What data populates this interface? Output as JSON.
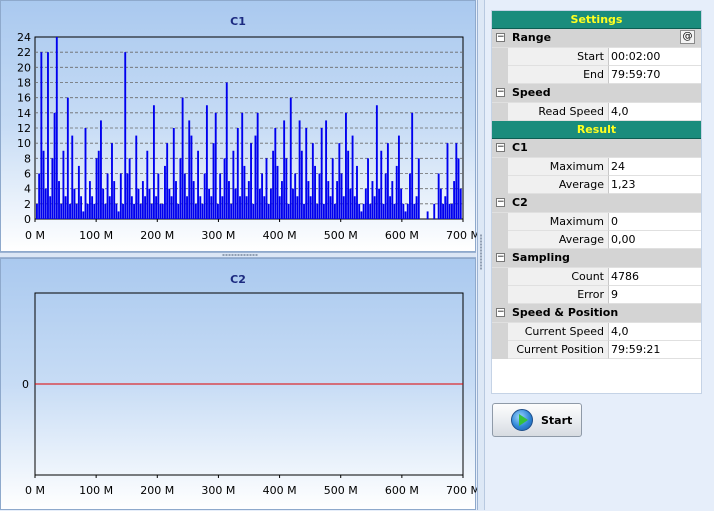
{
  "chart_c1": {
    "title": "C1",
    "y_ticks": [
      "0",
      "2",
      "4",
      "6",
      "8",
      "10",
      "12",
      "14",
      "16",
      "18",
      "20",
      "22",
      "24"
    ],
    "x_ticks": [
      "0 M",
      "100 M",
      "200 M",
      "300 M",
      "400 M",
      "500 M",
      "600 M",
      "700 M"
    ],
    "colors": {
      "series": "#0000ee",
      "grid": "#6a6a6a"
    }
  },
  "chart_c2": {
    "title": "C2",
    "y_ticks": [
      "0"
    ],
    "x_ticks": [
      "0 M",
      "100 M",
      "200 M",
      "300 M",
      "400 M",
      "500 M",
      "600 M",
      "700 M"
    ],
    "colors": {
      "series": "#e00000"
    }
  },
  "chart_data": [
    {
      "type": "bar",
      "title": "C1",
      "xlabel": "",
      "ylabel": "",
      "xlim": [
        0,
        700
      ],
      "ylim": [
        0,
        24
      ],
      "grid": true,
      "series": [
        {
          "values": [
            2,
            6,
            22,
            9,
            4,
            22,
            3,
            8,
            14,
            24,
            5,
            2,
            9,
            3,
            16,
            2,
            11,
            4,
            2,
            7,
            3,
            1,
            12,
            2,
            5,
            3,
            2,
            8,
            9,
            13,
            4,
            2,
            6,
            3,
            10,
            5,
            2,
            1,
            6,
            2,
            22,
            6,
            8,
            3,
            2,
            11,
            4,
            2,
            5,
            3,
            9,
            4,
            2,
            15,
            3,
            6,
            2,
            2,
            7,
            10,
            4,
            3,
            12,
            5,
            2,
            8,
            16,
            6,
            3,
            13,
            11,
            5,
            2,
            9,
            3,
            2,
            6,
            15,
            4,
            3,
            10,
            14,
            2,
            6,
            3,
            8,
            18,
            5,
            2,
            9,
            4,
            12,
            3,
            14,
            7,
            3,
            5,
            10,
            2,
            11,
            14,
            4,
            6,
            3,
            8,
            2,
            4,
            9,
            12,
            7,
            3,
            5,
            13,
            8,
            2,
            16,
            4,
            6,
            3,
            13,
            9,
            2,
            12,
            5,
            3,
            10,
            7,
            2,
            6,
            12,
            2,
            13,
            5,
            3,
            8,
            2,
            5,
            10,
            6,
            3,
            14,
            9,
            4,
            11,
            3,
            7,
            2,
            1,
            2,
            4,
            8,
            2,
            5,
            3,
            15,
            4,
            9,
            2,
            6,
            10,
            3,
            5,
            2,
            7,
            11,
            4,
            2,
            1,
            2,
            6,
            14,
            2,
            3,
            8,
            0,
            0,
            0,
            1,
            0,
            0,
            2,
            0,
            6,
            4,
            2,
            3,
            10,
            2,
            2,
            5,
            10,
            8,
            4
          ]
        }
      ]
    },
    {
      "type": "line",
      "title": "C2",
      "xlim": [
        0,
        700
      ],
      "series": [
        {
          "x": [
            0,
            700
          ],
          "y": [
            0,
            0
          ]
        }
      ]
    }
  ],
  "settings": {
    "header": "Settings",
    "range": {
      "label": "Range",
      "button": "@",
      "start_label": "Start",
      "start_value": "00:02:00",
      "end_label": "End",
      "end_value": "79:59:70"
    },
    "speed": {
      "label": "Speed",
      "read_speed_label": "Read Speed",
      "read_speed_value": "4,0"
    }
  },
  "result": {
    "header": "Result",
    "c1": {
      "label": "C1",
      "maximum_label": "Maximum",
      "maximum_value": "24",
      "average_label": "Average",
      "average_value": "1,23"
    },
    "c2": {
      "label": "C2",
      "maximum_label": "Maximum",
      "maximum_value": "0",
      "average_label": "Average",
      "average_value": "0,00"
    },
    "sampling": {
      "label": "Sampling",
      "count_label": "Count",
      "count_value": "4786",
      "error_label": "Error",
      "error_value": "9"
    },
    "speed_position": {
      "label": "Speed & Position",
      "current_speed_label": "Current Speed",
      "current_speed_value": "4,0",
      "current_position_label": "Current Position",
      "current_position_value": "79:59:21"
    }
  },
  "toggle_symbol": "−",
  "start_button": {
    "label": "Start",
    "icon": "play-icon"
  }
}
